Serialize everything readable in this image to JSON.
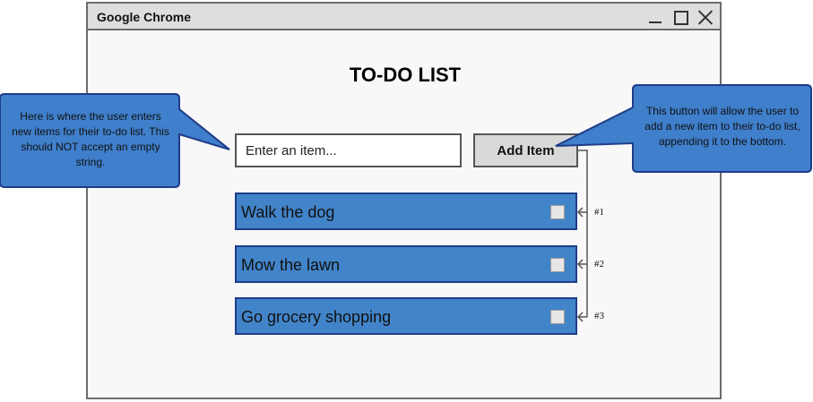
{
  "window": {
    "title": "Google Chrome"
  },
  "app": {
    "heading": "TO-DO LIST",
    "input_placeholder": "Enter an item...",
    "add_button_label": "Add Item"
  },
  "todo_items": [
    {
      "label": "Walk the dog",
      "number": "#1"
    },
    {
      "label": "Mow the lawn",
      "number": "#2"
    },
    {
      "label": "Go grocery shopping",
      "number": "#3"
    }
  ],
  "callouts": {
    "input_note": "Here is where the user enters new items for their to-do list. This should NOT accept an empty string.",
    "button_note": "This button will allow the user to add a new item to their to-do list, appending it to the bottom."
  },
  "colors": {
    "item_fill": "#4284c9",
    "item_border": "#1f3c88",
    "callout_fill": "#3f7fcb",
    "callout_border": "#1f3c88"
  }
}
